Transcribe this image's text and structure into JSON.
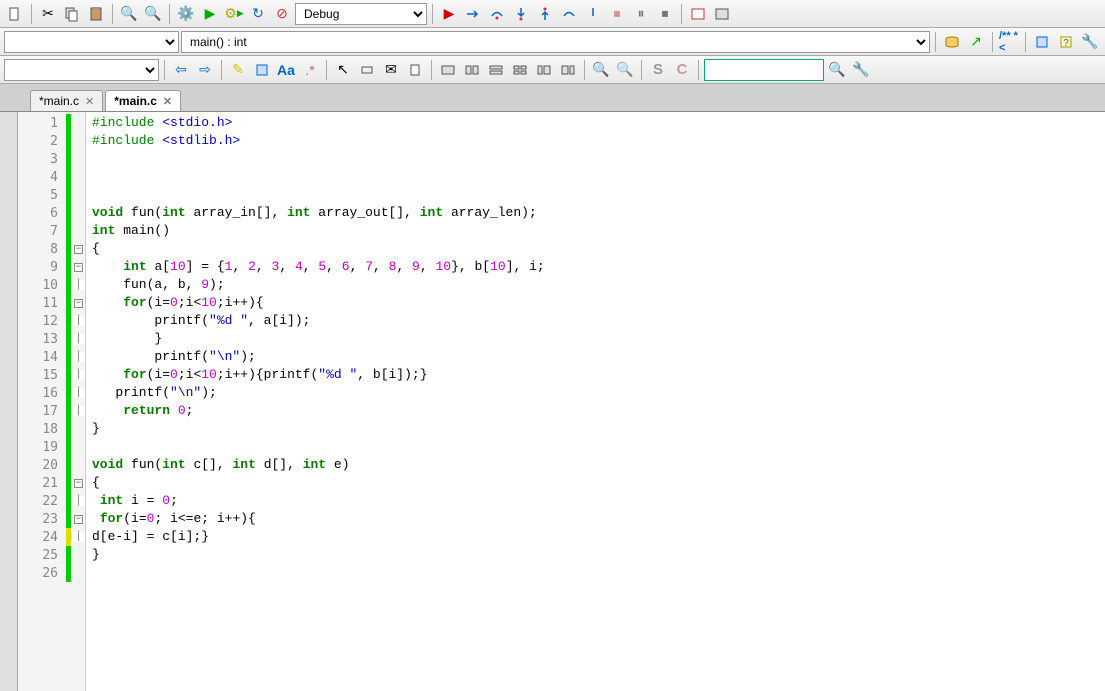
{
  "toolbar1": {
    "combo_config": "Debug"
  },
  "toolbar2": {
    "combo_scope": "main() : int"
  },
  "tabs": [
    {
      "label": "*main.c",
      "active": false
    },
    {
      "label": "*main.c",
      "active": true
    }
  ],
  "code_lines": [
    {
      "n": 1,
      "bar": "green",
      "fold": "",
      "tokens": [
        [
          "pp",
          "#include "
        ],
        [
          "str",
          "<stdio.h>"
        ]
      ]
    },
    {
      "n": 2,
      "bar": "green",
      "fold": "",
      "tokens": [
        [
          "pp",
          "#include "
        ],
        [
          "str",
          "<stdlib.h>"
        ]
      ]
    },
    {
      "n": 3,
      "bar": "green",
      "fold": "",
      "tokens": []
    },
    {
      "n": 4,
      "bar": "green",
      "fold": "",
      "tokens": []
    },
    {
      "n": 5,
      "bar": "green",
      "fold": "",
      "tokens": []
    },
    {
      "n": 6,
      "bar": "green",
      "fold": "",
      "tokens": [
        [
          "kw",
          "void "
        ],
        [
          "plain",
          "fun("
        ],
        [
          "kw",
          "int "
        ],
        [
          "plain",
          "array_in[], "
        ],
        [
          "kw",
          "int "
        ],
        [
          "plain",
          "array_out[], "
        ],
        [
          "kw",
          "int "
        ],
        [
          "plain",
          "array_len);"
        ]
      ]
    },
    {
      "n": 7,
      "bar": "green",
      "fold": "",
      "tokens": [
        [
          "kw",
          "int "
        ],
        [
          "plain",
          "main()"
        ]
      ]
    },
    {
      "n": 8,
      "bar": "green",
      "fold": "-",
      "tokens": [
        [
          "plain",
          "{"
        ]
      ]
    },
    {
      "n": 9,
      "bar": "green",
      "fold": "-",
      "tokens": [
        [
          "plain",
          "    "
        ],
        [
          "kw",
          "int "
        ],
        [
          "plain",
          "a["
        ],
        [
          "num",
          "10"
        ],
        [
          "plain",
          "] = {"
        ],
        [
          "num",
          "1"
        ],
        [
          "plain",
          ", "
        ],
        [
          "num",
          "2"
        ],
        [
          "plain",
          ", "
        ],
        [
          "num",
          "3"
        ],
        [
          "plain",
          ", "
        ],
        [
          "num",
          "4"
        ],
        [
          "plain",
          ", "
        ],
        [
          "num",
          "5"
        ],
        [
          "plain",
          ", "
        ],
        [
          "num",
          "6"
        ],
        [
          "plain",
          ", "
        ],
        [
          "num",
          "7"
        ],
        [
          "plain",
          ", "
        ],
        [
          "num",
          "8"
        ],
        [
          "plain",
          ", "
        ],
        [
          "num",
          "9"
        ],
        [
          "plain",
          ", "
        ],
        [
          "num",
          "10"
        ],
        [
          "plain",
          "}, b["
        ],
        [
          "num",
          "10"
        ],
        [
          "plain",
          "], i;"
        ]
      ]
    },
    {
      "n": 10,
      "bar": "green",
      "fold": "|",
      "tokens": [
        [
          "plain",
          "    fun(a, b, "
        ],
        [
          "num",
          "9"
        ],
        [
          "plain",
          ");"
        ]
      ]
    },
    {
      "n": 11,
      "bar": "green",
      "fold": "-",
      "tokens": [
        [
          "plain",
          "    "
        ],
        [
          "kw",
          "for"
        ],
        [
          "plain",
          "(i="
        ],
        [
          "num",
          "0"
        ],
        [
          "plain",
          ";i<"
        ],
        [
          "num",
          "10"
        ],
        [
          "plain",
          ";i++){"
        ]
      ]
    },
    {
      "n": 12,
      "bar": "green",
      "fold": "|",
      "tokens": [
        [
          "plain",
          "        printf("
        ],
        [
          "str",
          "\"%d \""
        ],
        [
          "plain",
          ", a[i]);"
        ]
      ]
    },
    {
      "n": 13,
      "bar": "green",
      "fold": "|",
      "tokens": [
        [
          "plain",
          "        }"
        ]
      ]
    },
    {
      "n": 14,
      "bar": "green",
      "fold": "|",
      "tokens": [
        [
          "plain",
          "        printf("
        ],
        [
          "str",
          "\"\\n\""
        ],
        [
          "plain",
          ");"
        ]
      ]
    },
    {
      "n": 15,
      "bar": "green",
      "fold": "|",
      "tokens": [
        [
          "plain",
          "    "
        ],
        [
          "kw",
          "for"
        ],
        [
          "plain",
          "(i="
        ],
        [
          "num",
          "0"
        ],
        [
          "plain",
          ";i<"
        ],
        [
          "num",
          "10"
        ],
        [
          "plain",
          ";i++){printf("
        ],
        [
          "str",
          "\"%d \""
        ],
        [
          "plain",
          ", b[i]);}"
        ]
      ]
    },
    {
      "n": 16,
      "bar": "green",
      "fold": "|",
      "tokens": [
        [
          "plain",
          "   printf("
        ],
        [
          "str",
          "\"\\n\""
        ],
        [
          "plain",
          ");"
        ]
      ]
    },
    {
      "n": 17,
      "bar": "green",
      "fold": "|",
      "tokens": [
        [
          "plain",
          "    "
        ],
        [
          "kw",
          "return "
        ],
        [
          "num",
          "0"
        ],
        [
          "plain",
          ";"
        ]
      ]
    },
    {
      "n": 18,
      "bar": "green",
      "fold": "",
      "tokens": [
        [
          "plain",
          "}"
        ]
      ]
    },
    {
      "n": 19,
      "bar": "green",
      "fold": "",
      "tokens": []
    },
    {
      "n": 20,
      "bar": "green",
      "fold": "",
      "tokens": [
        [
          "kw",
          "void "
        ],
        [
          "plain",
          "fun("
        ],
        [
          "kw",
          "int "
        ],
        [
          "plain",
          "c[], "
        ],
        [
          "kw",
          "int "
        ],
        [
          "plain",
          "d[], "
        ],
        [
          "kw",
          "int "
        ],
        [
          "plain",
          "e)"
        ]
      ]
    },
    {
      "n": 21,
      "bar": "green",
      "fold": "-",
      "tokens": [
        [
          "plain",
          "{"
        ]
      ]
    },
    {
      "n": 22,
      "bar": "green",
      "fold": "|",
      "tokens": [
        [
          "plain",
          " "
        ],
        [
          "kw",
          "int "
        ],
        [
          "plain",
          "i = "
        ],
        [
          "num",
          "0"
        ],
        [
          "plain",
          ";"
        ]
      ]
    },
    {
      "n": 23,
      "bar": "green",
      "fold": "-",
      "tokens": [
        [
          "plain",
          " "
        ],
        [
          "kw",
          "for"
        ],
        [
          "plain",
          "(i="
        ],
        [
          "num",
          "0"
        ],
        [
          "plain",
          "; i<=e; i++){"
        ]
      ]
    },
    {
      "n": 24,
      "bar": "yellow",
      "fold": "|",
      "tokens": [
        [
          "plain",
          "d[e-i] = c[i];}"
        ]
      ]
    },
    {
      "n": 25,
      "bar": "green",
      "fold": "",
      "tokens": [
        [
          "plain",
          "}"
        ]
      ]
    },
    {
      "n": 26,
      "bar": "green",
      "fold": "",
      "tokens": []
    }
  ]
}
